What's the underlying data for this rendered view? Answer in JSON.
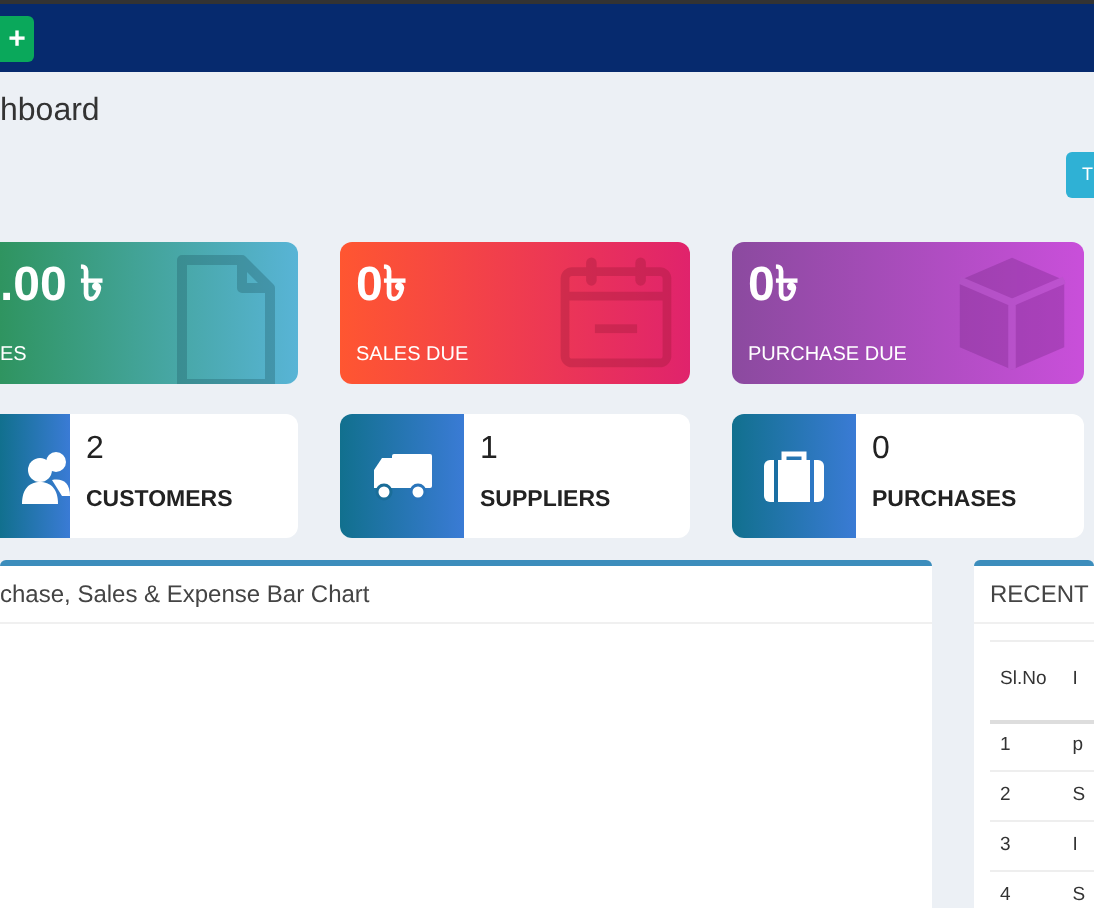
{
  "navbar": {
    "add_button": "+"
  },
  "page_title": "hboard",
  "toolbar_button": "T",
  "summary_cards": [
    {
      "kind": "sales",
      "value": ".00 ৳",
      "label": "ES"
    },
    {
      "kind": "sales_due",
      "value": "0৳",
      "label": "SALES DUE"
    },
    {
      "kind": "purchase_due",
      "value": "0৳",
      "label": "PURCHASE DUE"
    }
  ],
  "count_boxes": [
    {
      "kind": "customers",
      "count": "2",
      "label": "CUSTOMERS"
    },
    {
      "kind": "suppliers",
      "count": "1",
      "label": "SUPPLIERS"
    },
    {
      "kind": "purchases",
      "count": "0",
      "label": "PURCHASES"
    }
  ],
  "chart_panel": {
    "title": "chase, Sales & Expense Bar Chart"
  },
  "recent_panel": {
    "title": "RECENT",
    "columns": [
      "Sl.No",
      "I"
    ],
    "rows": [
      [
        "1",
        "p"
      ],
      [
        "2",
        "S"
      ],
      [
        "3",
        "I"
      ],
      [
        "4",
        "S"
      ]
    ]
  }
}
